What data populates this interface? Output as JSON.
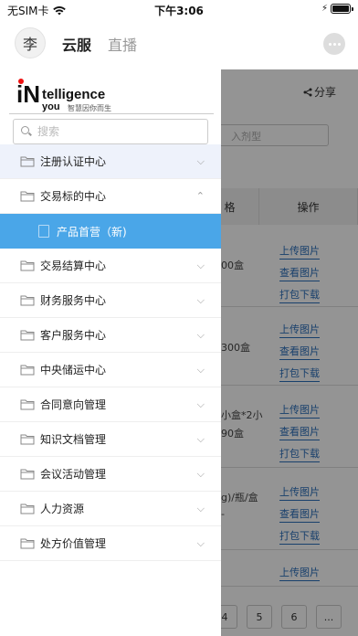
{
  "status_bar": {
    "carrier": "无SIM卡",
    "time": "下午3:06",
    "icons": [
      "wifi-icon",
      "battery-icon",
      "charging-icon"
    ]
  },
  "top_nav": {
    "avatar_text": "李",
    "tabs": [
      {
        "label": "云服",
        "active": true
      },
      {
        "label": "直播",
        "active": false
      }
    ],
    "chat_icon": "chat-bubble-icon"
  },
  "drawer": {
    "logo": {
      "brand_line1": "telligence",
      "brand_line2": "you",
      "brand_prefix": "iN",
      "slogan": "智慧因你而生"
    },
    "search": {
      "placeholder": "搜索",
      "value": ""
    },
    "menu": [
      {
        "label": "注册认证中心",
        "expanded": false,
        "highlight": true
      },
      {
        "label": "交易标的中心",
        "expanded": true,
        "highlight": false,
        "children": [
          {
            "label": "产品首营（新)",
            "selected": true
          }
        ]
      },
      {
        "label": "交易结算中心",
        "expanded": false
      },
      {
        "label": "财务服务中心",
        "expanded": false
      },
      {
        "label": "客户服务中心",
        "expanded": false
      },
      {
        "label": "中央储运中心",
        "expanded": false
      },
      {
        "label": "合同意向管理",
        "expanded": false
      },
      {
        "label": "知识文档管理",
        "expanded": false
      },
      {
        "label": "会议活动管理",
        "expanded": false
      },
      {
        "label": "人力资源",
        "expanded": false
      },
      {
        "label": "处方价值管理",
        "expanded": false
      }
    ],
    "colors": {
      "selected_bg": "#4aa6e8",
      "highlight_bg": "#eef2fb"
    }
  },
  "background_page": {
    "share_label": "分享",
    "search_placeholder": "入剂型",
    "table_headers": [
      "格",
      "操作"
    ],
    "rows": [
      {
        "cell": "00盒",
        "links": [
          "上传图片",
          "查看图片",
          "打包下载"
        ]
      },
      {
        "cell": "300盒",
        "links": [
          "上传图片",
          "查看图片",
          "打包下载"
        ]
      },
      {
        "cell": "小盒*2小",
        "cell2": "90盒",
        "links": [
          "上传图片",
          "查看图片",
          "打包下载"
        ]
      },
      {
        "cell": "g)/瓶/盒",
        "cell2": "-",
        "links": [
          "上传图片",
          "查看图片",
          "打包下载"
        ]
      },
      {
        "cell": "",
        "links": [
          "上传图片"
        ]
      }
    ],
    "pager": [
      "4",
      "5",
      "6",
      "..."
    ]
  }
}
